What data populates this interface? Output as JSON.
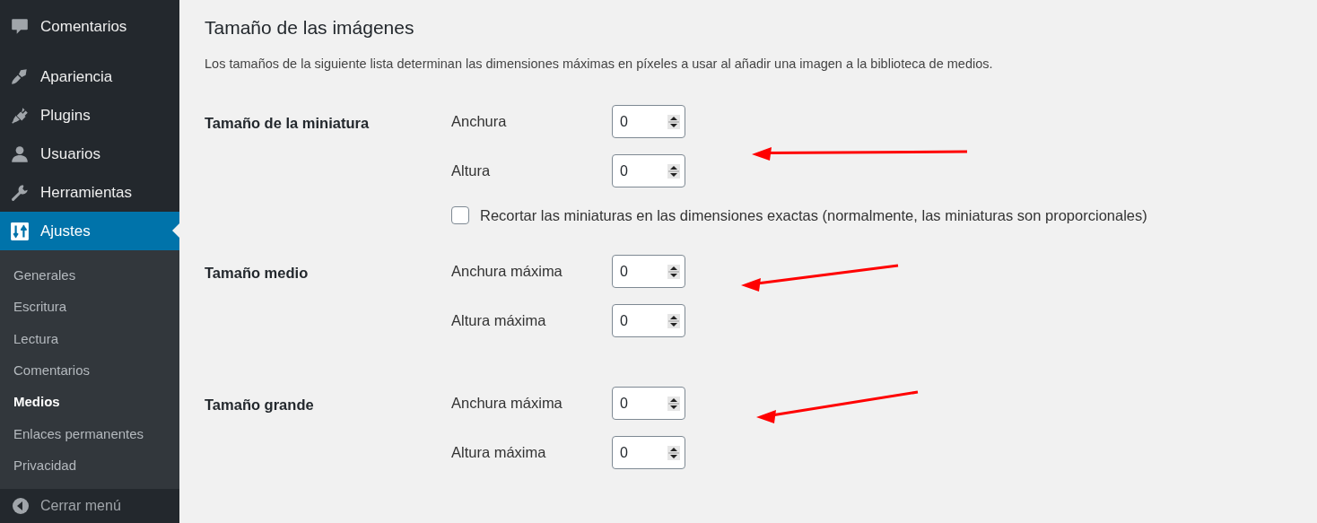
{
  "sidebar": {
    "items": [
      {
        "label": "Comentarios",
        "selected": false
      },
      {
        "label": "Apariencia",
        "selected": false
      },
      {
        "label": "Plugins",
        "selected": false
      },
      {
        "label": "Usuarios",
        "selected": false
      },
      {
        "label": "Herramientas",
        "selected": false
      },
      {
        "label": "Ajustes",
        "selected": true
      }
    ],
    "submenu": [
      {
        "label": "Generales",
        "selected": false
      },
      {
        "label": "Escritura",
        "selected": false
      },
      {
        "label": "Lectura",
        "selected": false
      },
      {
        "label": "Comentarios",
        "selected": false
      },
      {
        "label": "Medios",
        "selected": true
      },
      {
        "label": "Enlaces permanentes",
        "selected": false
      },
      {
        "label": "Privacidad",
        "selected": false
      }
    ],
    "collapse": "Cerrar menú"
  },
  "page": {
    "title": "Tamaño de las imágenes",
    "description": "Los tamaños de la siguiente lista determinan las dimensiones máximas en píxeles a usar al añadir una imagen a la biblioteca de medios.",
    "sections": [
      {
        "label": "Tamaño de la miniatura",
        "annotated": true,
        "fields": [
          {
            "label": "Anchura",
            "value": "0"
          },
          {
            "label": "Altura",
            "value": "0"
          }
        ],
        "checkbox": {
          "label": "Recortar las miniaturas en las dimensiones exactas (normalmente, las miniaturas son proporcionales)",
          "checked": false
        }
      },
      {
        "label": "Tamaño medio",
        "annotated": true,
        "fields": [
          {
            "label": "Anchura máxima",
            "value": "0"
          },
          {
            "label": "Altura máxima",
            "value": "0"
          }
        ]
      },
      {
        "label": "Tamaño grande",
        "annotated": true,
        "fields": [
          {
            "label": "Anchura máxima",
            "value": "0"
          },
          {
            "label": "Altura máxima",
            "value": "0"
          }
        ]
      }
    ]
  }
}
